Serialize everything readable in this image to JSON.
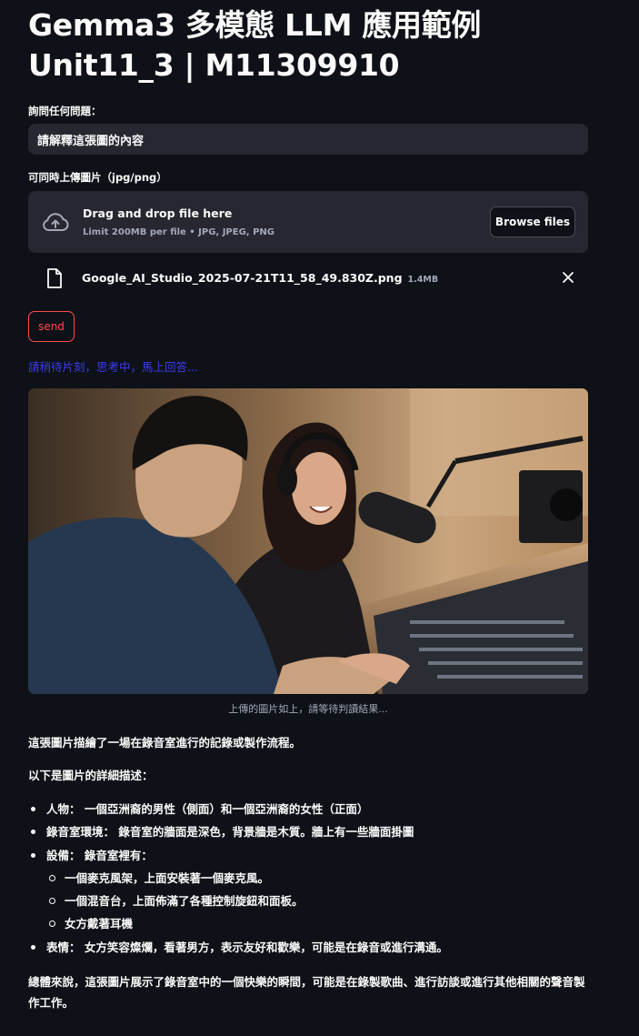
{
  "header": {
    "title_line1": "Gemma3 多模態 LLM 應用範例",
    "title_line2": "Unit11_3 | M11309910"
  },
  "question": {
    "label": "詢問任何問題：",
    "value": "請解釋這張圖的內容"
  },
  "uploader": {
    "label": "可同時上傳圖片（jpg/png）",
    "drop_title": "Drag and drop file here",
    "limit_text": "Limit 200MB per file • JPG, JPEG, PNG",
    "browse_label": "Browse files",
    "icon": "cloud-upload-icon"
  },
  "uploaded_file": {
    "name": "Google_AI_Studio_2025-07-21T11_58_49.830Z.png",
    "size": "1.4MB",
    "icon": "file-icon",
    "remove_icon": "close-icon"
  },
  "send_button": {
    "label": "send"
  },
  "status_text": "請稍待片刻，思考中，馬上回答...",
  "image_caption": "上傳的圖片如上，請等待判讀結果...",
  "answer": {
    "intro": "這張圖片描繪了一場在錄音室進行的記錄或製作流程。",
    "details_heading": "以下是圖片的詳細描述：",
    "bullets": [
      {
        "term": "人物：",
        "text": "一個亞洲裔的男性（側面）和一個亞洲裔的女性（正面）"
      },
      {
        "term": "錄音室環境：",
        "text": "錄音室的牆面是深色，背景牆是木質。牆上有一些牆面掛圖"
      },
      {
        "term": "設備：",
        "text": "錄音室裡有："
      },
      {
        "term": "表情：",
        "text": "女方笑容燦爛，看著男方，表示友好和歡樂，可能是在錄音或進行溝通。"
      }
    ],
    "equipment_items": [
      "一個麥克風架，上面安裝著一個麥克風。",
      "一個混音台，上面佈滿了各種控制旋鈕和面板。",
      "女方戴著耳機"
    ],
    "conclusion": "總體來說，這張圖片展示了錄音室中的一個快樂的瞬間，可能是在錄製歌曲、進行訪談或進行其他相關的聲音製作工作。"
  },
  "colors": {
    "background": "#0e1117",
    "input_bg": "#262730",
    "accent_red": "#ff4b4b",
    "status_blue": "#3c3cf0",
    "muted": "#a3a8b8"
  }
}
